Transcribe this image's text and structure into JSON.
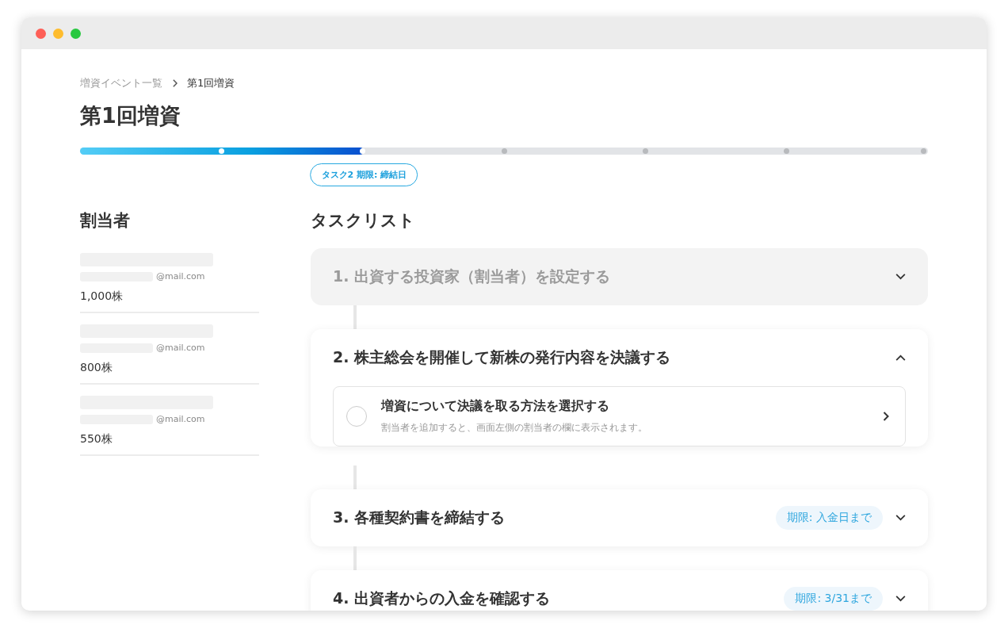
{
  "breadcrumb": [
    {
      "label": "増資イベント一覧",
      "current": false
    },
    {
      "label": "第1回増資",
      "current": true
    }
  ],
  "title": "第1回増資",
  "progress": {
    "level": 0.335,
    "badge": "タスク2 期限: 締結日"
  },
  "assignees": {
    "heading": "割当者",
    "items": [
      {
        "email": "@mail.com",
        "shares": "1,000株"
      },
      {
        "email": "@mail.com",
        "shares": "800株"
      },
      {
        "email": "@mail.com",
        "shares": "550株"
      }
    ]
  },
  "tasks": {
    "heading": "タスクリスト",
    "items": [
      {
        "title": "1. 出資する投資家（割当者）を設定する",
        "disabled": true,
        "expanded": false
      },
      {
        "title": "2. 株主総会を開催して新株の発行内容を決議する",
        "disabled": false,
        "expanded": true,
        "subtasks": [
          {
            "title": "増資について決議を取る方法を選択する",
            "description": "割当者を追加すると、画面左側の割当者の欄に表示されます。",
            "checked": false
          }
        ]
      },
      {
        "title": "3. 各種契約書を締結する",
        "disabled": false,
        "expanded": false,
        "deadline": "期限: 入金日まで"
      },
      {
        "title": "4. 出資者からの入金を確認する",
        "disabled": false,
        "expanded": false,
        "deadline": "期限: 3/31まで"
      }
    ]
  }
}
